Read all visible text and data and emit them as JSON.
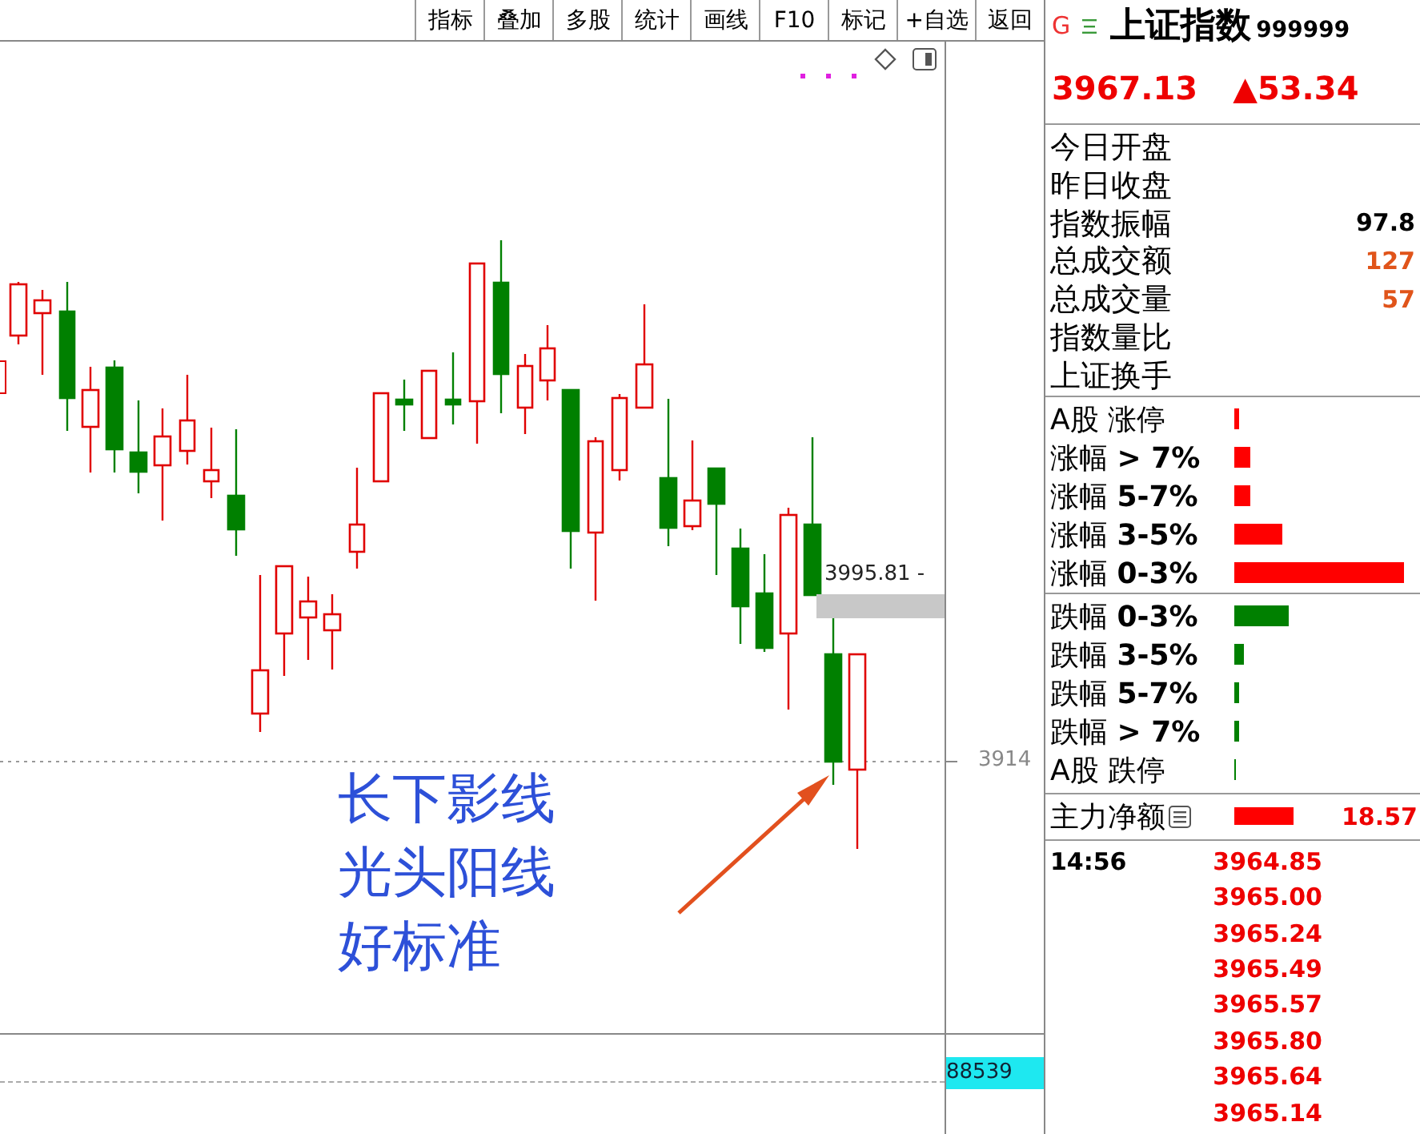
{
  "toolbar": {
    "buttons": [
      "指标",
      "叠加",
      "多股",
      "统计",
      "画线",
      "F10",
      "标记",
      "+自选",
      "返回"
    ]
  },
  "chart": {
    "price_label": "3995.81 -",
    "axis_label": "3914",
    "annotation": [
      "长下影线",
      "光头阳线",
      "好标准"
    ]
  },
  "volume": {
    "axis_label": "88539"
  },
  "quote": {
    "logo": "G",
    "name": "上证指数",
    "code": "999999",
    "price": "3967.13",
    "change": "▲53.34"
  },
  "stats": [
    {
      "label": "今日开盘"
    },
    {
      "label": "昨日收盘"
    },
    {
      "label": "指数振幅",
      "value": "97.8",
      "color": "#000000"
    },
    {
      "label": "总成交额",
      "value": "127",
      "color": "#e0541a"
    },
    {
      "label": "总成交量",
      "value": "57",
      "color": "#e0541a"
    },
    {
      "label": "指数量比"
    },
    {
      "label": "上证换手"
    }
  ],
  "rises": [
    {
      "label": "A股 涨停",
      "level": 0.03,
      "color": "#ff0000"
    },
    {
      "label": "涨幅 **> 7%**",
      "level": 0.09,
      "color": "#ff0000"
    },
    {
      "label": "涨幅 **5-7%**",
      "level": 0.09,
      "color": "#ff0000"
    },
    {
      "label": "涨幅 **3-5%**",
      "level": 0.26,
      "color": "#ff0000"
    },
    {
      "label": "涨幅 **0-3%**",
      "level": 0.91,
      "color": "#ff0000"
    }
  ],
  "falls": [
    {
      "label": "跌幅 **0-3%**",
      "level": 0.29,
      "color": "#008000"
    },
    {
      "label": "跌幅 **3-5%**",
      "level": 0.05,
      "color": "#008000"
    },
    {
      "label": "跌幅 **5-7%**",
      "level": 0.03,
      "color": "#008000"
    },
    {
      "label": "跌幅 **> 7%**",
      "level": 0.03,
      "color": "#008000"
    },
    {
      "label": "A股 跌停",
      "level": 0.01,
      "color": "#008000"
    }
  ],
  "net": {
    "label": "主力净额",
    "level": 0.62,
    "value": "18.57"
  },
  "ticks": [
    {
      "time": "14:56",
      "price": "3964.85"
    },
    {
      "price": "3965.00"
    },
    {
      "price": "3965.24"
    },
    {
      "price": "3965.49"
    },
    {
      "price": "3965.57"
    },
    {
      "price": "3965.80"
    },
    {
      "price": "3965.64"
    },
    {
      "price": "3965.14"
    }
  ]
}
